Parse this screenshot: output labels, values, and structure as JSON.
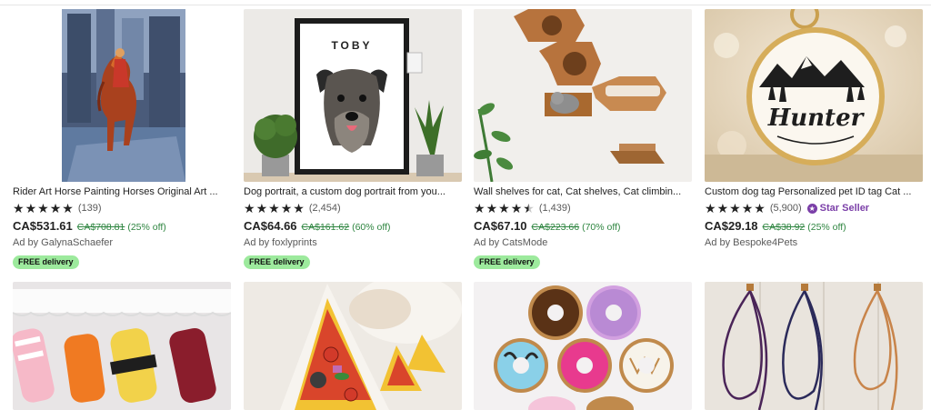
{
  "listings": [
    {
      "title": "Rider Art Horse Painting Horses Original Art ...",
      "rating": 5,
      "review_count": "(139)",
      "price": "CA$531.61",
      "original_price": "CA$708.81",
      "discount": "(25% off)",
      "ad_by": "Ad by GalynaSchaefer",
      "badge": "FREE delivery"
    },
    {
      "title": "Dog portrait, a custom dog portrait from you...",
      "rating": 5,
      "review_count": "(2,454)",
      "price": "CA$64.66",
      "original_price": "CA$161.62",
      "discount": "(60% off)",
      "ad_by": "Ad by foxlyprints",
      "badge": "FREE delivery",
      "image_text": "TOBY"
    },
    {
      "title": "Wall shelves for cat, Cat shelves, Cat climbin...",
      "rating": 4.5,
      "review_count": "(1,439)",
      "price": "CA$67.10",
      "original_price": "CA$223.66",
      "discount": "(70% off)",
      "ad_by": "Ad by CatsMode",
      "badge": "FREE delivery"
    },
    {
      "title": "Custom dog tag Personalized pet ID tag Cat ...",
      "rating": 5,
      "review_count": "(5,900)",
      "star_seller": "Star Seller",
      "price": "CA$29.18",
      "original_price": "CA$38.92",
      "discount": "(25% off)",
      "ad_by": "Ad by Bespoke4Pets",
      "image_text": "Hunter"
    }
  ],
  "colors": {
    "accent_green": "#2e8540",
    "badge_green": "#9dea9d",
    "star_seller_purple": "#7b3fa8"
  },
  "icons": [
    "star-icon",
    "star-seller-icon"
  ]
}
